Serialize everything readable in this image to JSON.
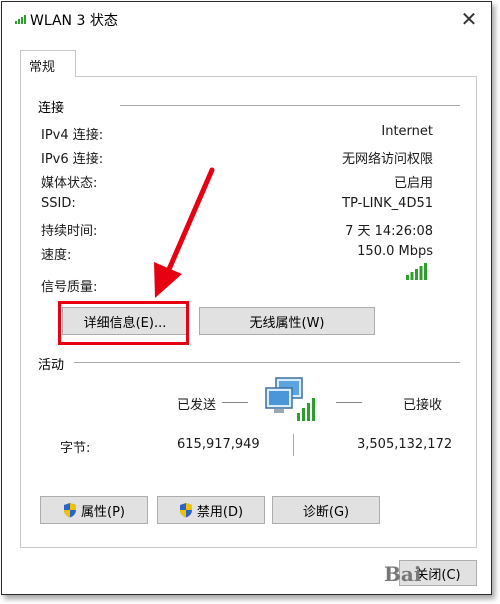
{
  "window": {
    "title": "WLAN 3 状态"
  },
  "tabs": [
    {
      "label": "常规"
    }
  ],
  "connection": {
    "section_label": "连接",
    "rows": [
      {
        "label": "IPv4 连接:",
        "value": "Internet"
      },
      {
        "label": "IPv6 连接:",
        "value": "无网络访问权限"
      },
      {
        "label": "媒体状态:",
        "value": "已启用"
      },
      {
        "label": "SSID:",
        "value": "TP-LINK_4D51"
      },
      {
        "label": "持续时间:",
        "value": "7 天 14:26:08"
      },
      {
        "label": "速度:",
        "value": "150.0 Mbps"
      }
    ],
    "signal_label": "信号质量:",
    "signal_bars": 5,
    "details_button": "详细信息(E)...",
    "wireless_button": "无线属性(W)"
  },
  "activity": {
    "section_label": "活动",
    "sent_label": "已发送",
    "received_label": "已接收",
    "bytes_label": "字节:",
    "bytes_sent": "615,917,949",
    "bytes_received": "3,505,132,172"
  },
  "buttons": {
    "properties": "属性(P)",
    "disable": "禁用(D)",
    "diagnose": "诊断(G)",
    "close": "关闭(C)"
  },
  "watermark": "Bai",
  "colors": {
    "highlight": "#e60012",
    "signal": "#2e9e2e"
  },
  "icons": [
    "wifi-signal-icon",
    "close-icon",
    "network-computers-icon",
    "shield-icon",
    "red-arrow"
  ]
}
